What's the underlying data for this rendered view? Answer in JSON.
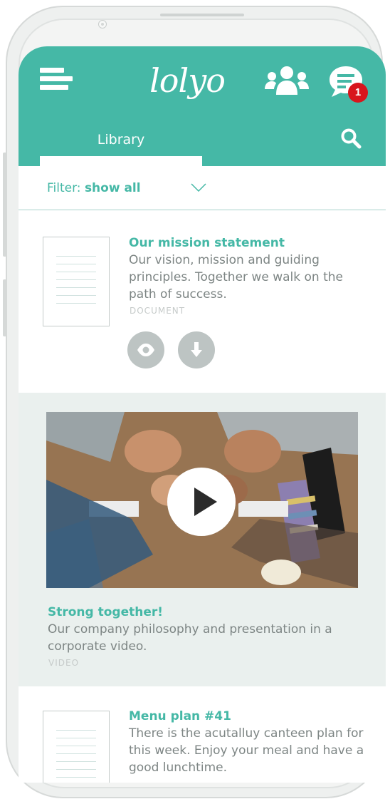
{
  "colors": {
    "brand_teal": "#45b8a6",
    "badge_red": "#d8161d",
    "muted_gray": "#bdc4c3",
    "video_card_bg": "#eaf0ee"
  },
  "header": {
    "logo_text": "lolyo",
    "menu_icon": "hamburger-menu-icon",
    "group_icon": "users-group-icon",
    "chat_icon": "chat-bubble-icon",
    "chat_badge": "1",
    "tab_label": "Library",
    "search_icon": "search-icon"
  },
  "filter": {
    "label": "Filter:",
    "value": "show all",
    "chevron_icon": "chevron-down-icon"
  },
  "items": [
    {
      "title": "Our mission statement",
      "description": "Our vision, mission and guiding principles. Together we walk on the path of success.",
      "type": "DOCUMENT",
      "actions": [
        "eye-icon",
        "download-icon"
      ]
    },
    {
      "title": "Strong together!",
      "description": "Our company philosophy and presentation in a corporate video.",
      "type": "VIDEO",
      "play_icon": "play-icon"
    },
    {
      "title": "Menu plan #41",
      "description": "There is the acutalluy canteen plan for this week. Enjoy your meal and have a good lunchtime."
    }
  ]
}
